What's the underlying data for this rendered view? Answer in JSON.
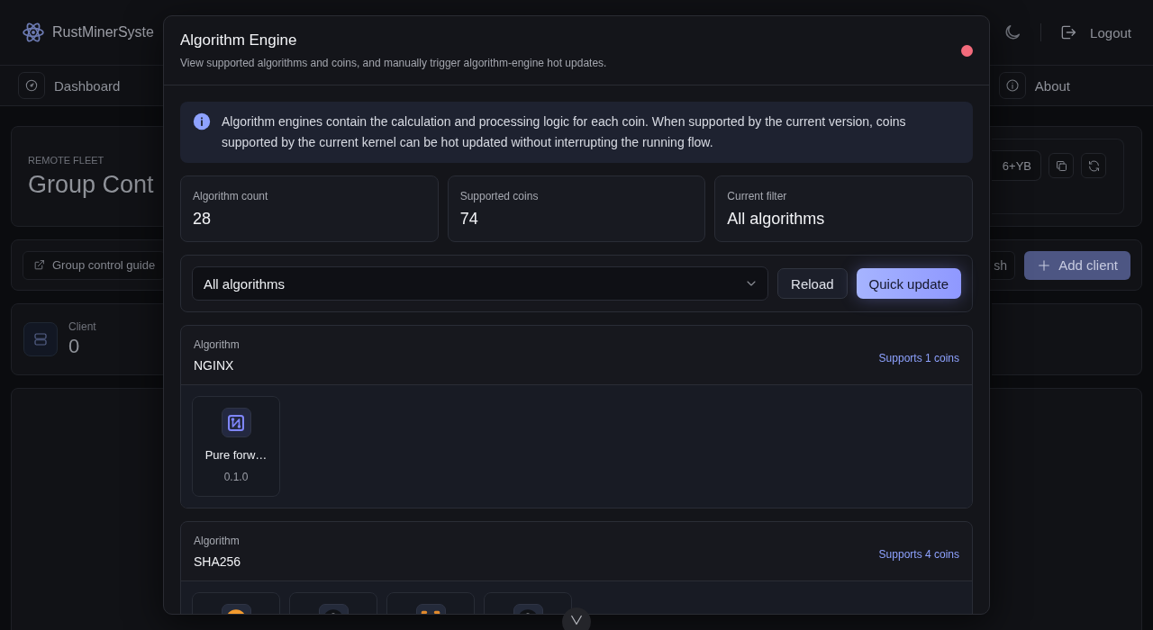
{
  "app": {
    "brand": "RustMinerSyste",
    "logout": "Logout"
  },
  "nav": [
    {
      "label": "Dashboard"
    },
    {
      "label": "About"
    }
  ],
  "page": {
    "eyebrow": "REMOTE FLEET",
    "title": "Group Cont",
    "token": "6+YB",
    "guide": "Group control guide",
    "refresh": "sh",
    "add": "Add client",
    "stat": {
      "label": "Client",
      "value": "0"
    }
  },
  "dialog": {
    "title": "Algorithm Engine",
    "subtitle": "View supported algorithms and coins, and manually trigger algorithm-engine hot updates.",
    "info": "Algorithm engines contain the calculation and processing logic for each coin. When supported by the current version, coins supported by the current kernel can be hot updated without interrupting the running flow.",
    "summary": [
      {
        "label": "Algorithm count",
        "value": "28"
      },
      {
        "label": "Supported coins",
        "value": "74"
      },
      {
        "label": "Current filter",
        "value": "All algorithms"
      }
    ],
    "filter": {
      "value": "All algorithms"
    },
    "buttons": [
      {
        "label": "Reload",
        "kind": "secondary"
      },
      {
        "label": "Quick update",
        "kind": "primary"
      }
    ],
    "algorithms": [
      {
        "label": "Algorithm",
        "name": "NGINX",
        "support": "Supports 1 coins",
        "coins": [
          {
            "kind": "coin",
            "name": "Pure forw…",
            "version": "0.1.0"
          }
        ]
      },
      {
        "label": "Algorithm",
        "name": "SHA256",
        "support": "Supports 4 coins",
        "coins": [
          {
            "kind": "coin"
          },
          {
            "kind": "coin"
          },
          {
            "kind": "coin"
          },
          {
            "kind": "coin"
          }
        ]
      }
    ]
  }
}
